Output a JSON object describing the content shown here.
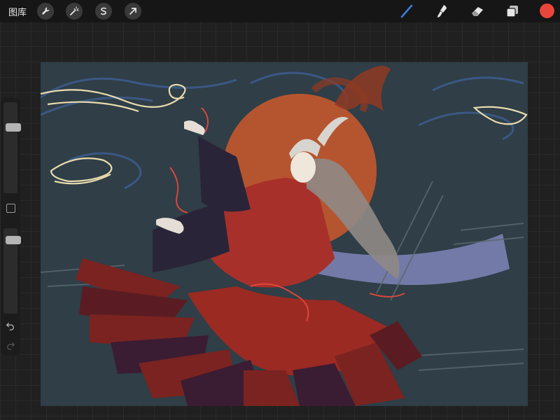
{
  "topbar": {
    "gallery_label": "图库",
    "left_tools": [
      "wrench-icon",
      "magic-wand-icon",
      "selection-s-icon",
      "arrow-transform-icon"
    ],
    "right_tools": [
      "brush-icon",
      "smudge-icon",
      "eraser-icon",
      "layers-icon"
    ],
    "active_color": "#e8453c",
    "active_tool_color": "#3b7ad9"
  },
  "sidebar": {
    "brush_size_level": 0.75,
    "opacity_level": 0.9,
    "buttons": [
      "modify-square",
      "undo-icon",
      "redo-icon"
    ]
  },
  "canvas": {
    "background": "#2f3e47",
    "sun_color": "#b5552f",
    "robe_color": "#9a2a22",
    "ribbon_color": "#8b8fc7",
    "cloud_color": "#e8dcae"
  }
}
